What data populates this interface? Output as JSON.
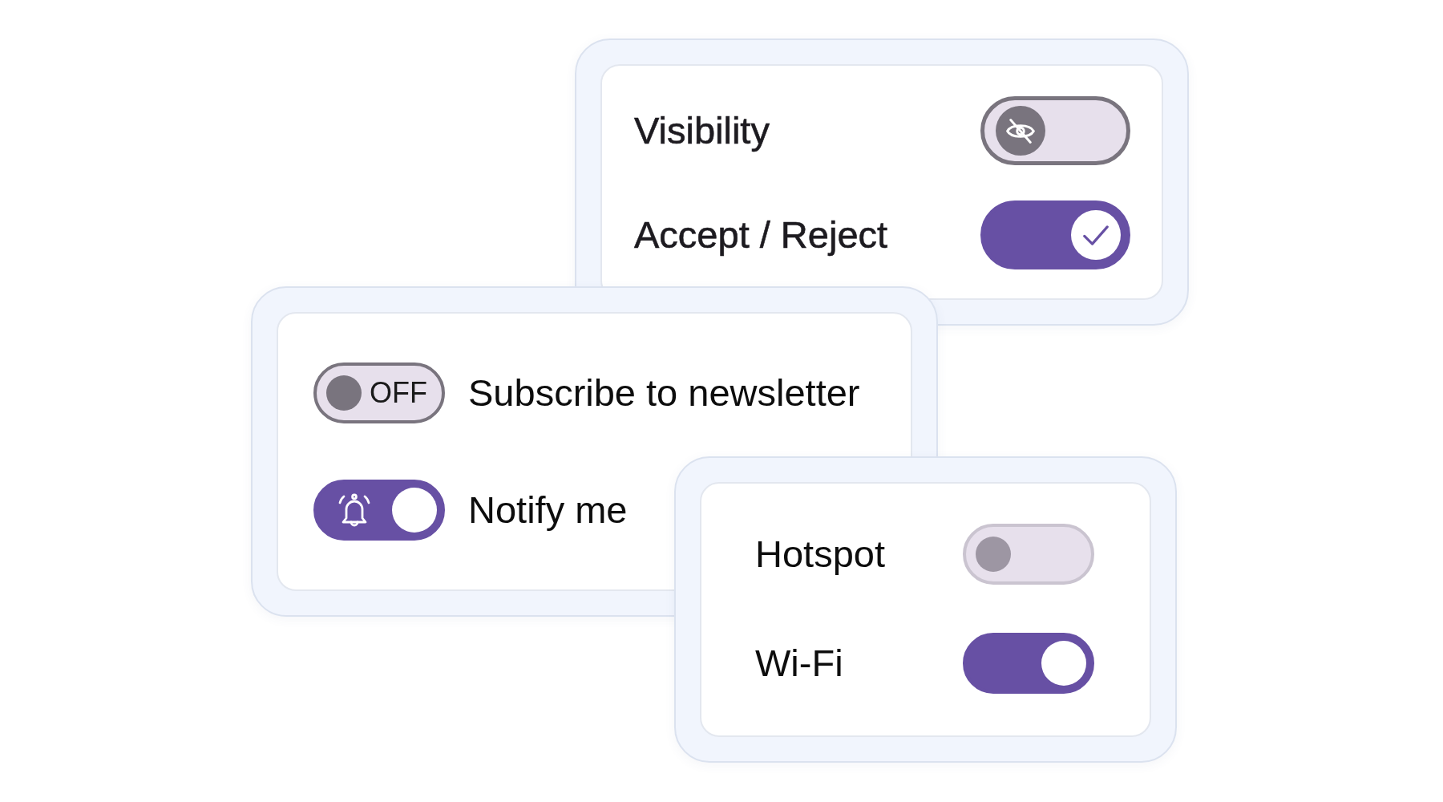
{
  "cards": [
    {
      "kind": "trailing-switch",
      "toggles": [
        {
          "kind": "thumb-icon",
          "label": "Visibility",
          "on": false,
          "disabled": false
        },
        {
          "kind": "thumb-icon",
          "label": "Accept / Reject",
          "on": true,
          "disabled": false
        }
      ]
    },
    {
      "kind": "leading-switch",
      "toggles": [
        {
          "kind": "track-text",
          "label": "Subscribe to newsletter",
          "track_text": "OFF",
          "on": false,
          "disabled": false
        },
        {
          "kind": "track-icon",
          "label": "Notify me",
          "on": true,
          "disabled": false
        }
      ]
    },
    {
      "kind": "trailing-switch",
      "toggles": [
        {
          "kind": "plain",
          "label": "Hotspot",
          "on": false,
          "disabled": true
        },
        {
          "kind": "plain",
          "label": "Wi-Fi",
          "on": true,
          "disabled": false
        }
      ]
    }
  ]
}
